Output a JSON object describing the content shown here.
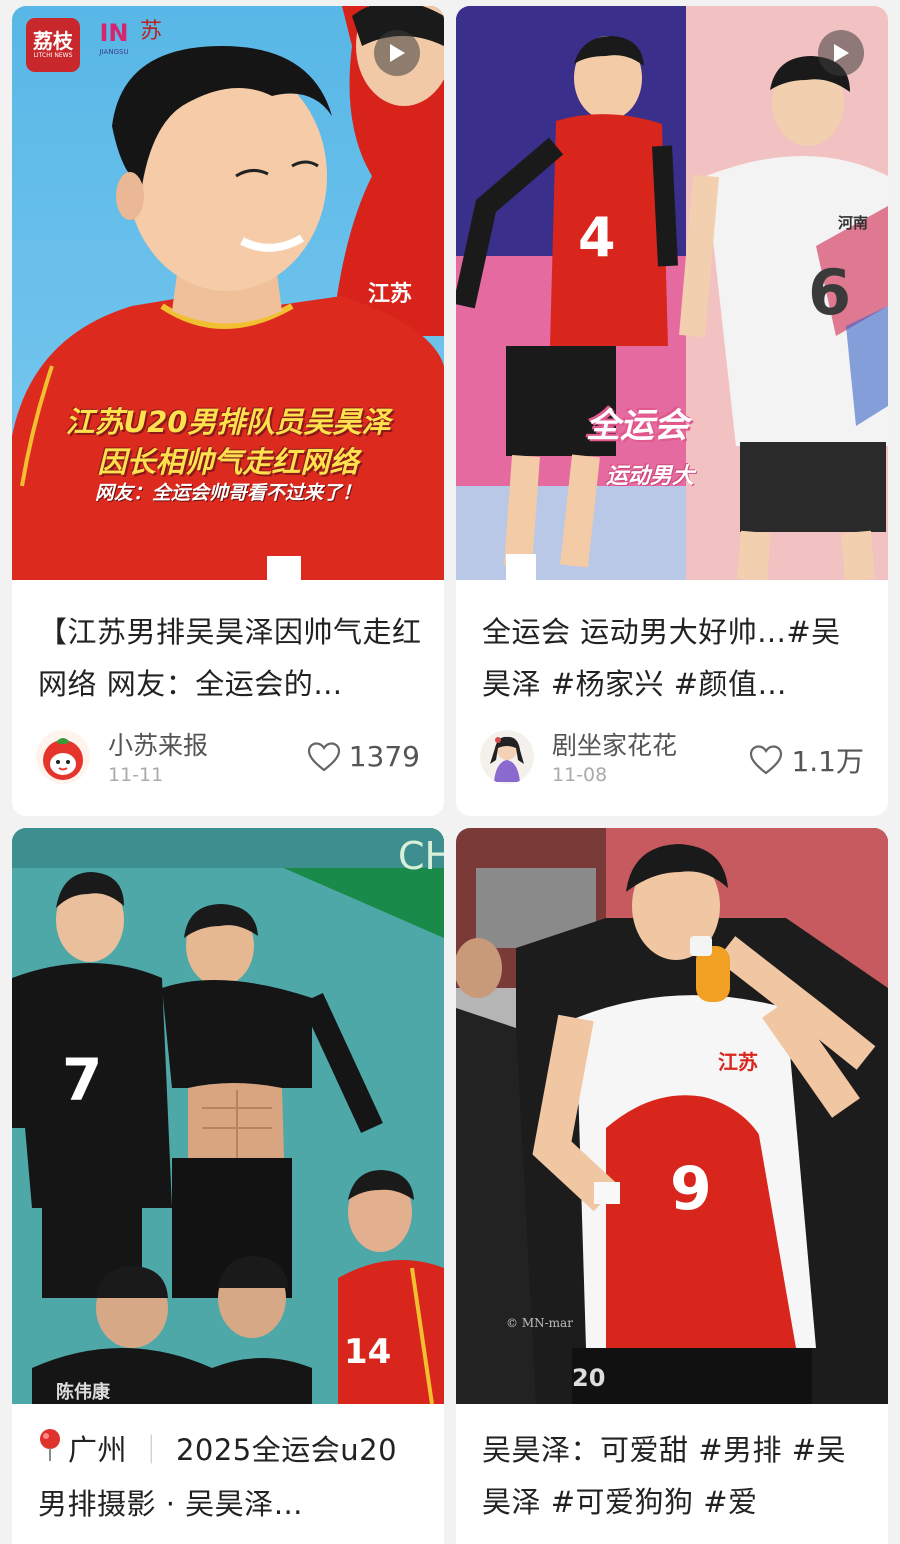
{
  "cards": [
    {
      "title": "【江苏男排吴昊泽因帅气走红网络 网友：全运会的…",
      "author": "小苏来报",
      "date": "11-11",
      "likes": "1379",
      "overlay_line1": "江苏U20男排队员吴昊泽",
      "overlay_line2": "因长相帅气走红网络",
      "overlay_line3": "网友：全运会帅哥看不过来了！",
      "logo_left_big": "荔枝",
      "logo_left_small": "LITCHI NEWS",
      "logo_mid": "IN",
      "logo_mid_sub": "JIANGSU",
      "logo_right": "苏",
      "jersey_text": "江苏",
      "is_video": true
    },
    {
      "title": "全运会 运动男大好帅...#吴昊泽 #杨家兴 #颜值…",
      "author": "剧坐家花花",
      "date": "11-08",
      "likes": "1.1万",
      "overlay_line1": "全运会",
      "overlay_line2": "运动男大",
      "jersey_left": "4",
      "jersey_right": "6",
      "jersey_right_team": "河南",
      "is_video": true
    },
    {
      "title": "广州 ｜ 2025全运会u20男排摄影 · 吴昊泽…",
      "title_location": "广州",
      "title_rest": "2025全运会u20男排摄影 · 吴昊泽…",
      "jersey_a": "7",
      "jersey_b": "14",
      "name_band": "陈伟康",
      "banner": "CH"
    },
    {
      "title": "吴昊泽：可爱甜 #男排 #吴昊泽 #可爱狗狗 #爱",
      "jersey": "9",
      "jersey_team": "江苏",
      "watermark": "© MN-mar",
      "back_num": "20"
    }
  ],
  "colors": {
    "background": "#f2f2f2",
    "card": "#ffffff",
    "text": "#222222",
    "muted": "#aaaaaa",
    "jersey_red": "#d9261c"
  }
}
